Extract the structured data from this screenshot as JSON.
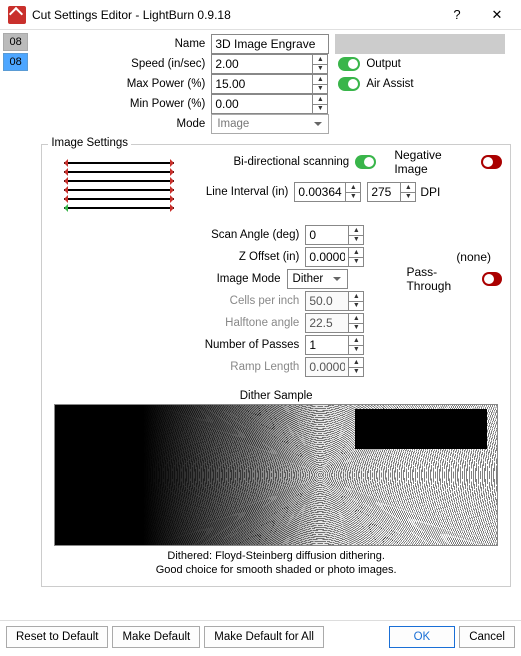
{
  "title": "Cut Settings Editor - LightBurn 0.9.18",
  "layers": [
    "08",
    "08"
  ],
  "top": {
    "name_label": "Name",
    "name_value": "3D Image Engrave",
    "speed_label": "Speed (in/sec)",
    "speed_value": "2.00",
    "maxpower_label": "Max Power (%)",
    "maxpower_value": "15.00",
    "minpower_label": "Min Power (%)",
    "minpower_value": "0.00",
    "mode_label": "Mode",
    "mode_value": "Image",
    "output_label": "Output",
    "airassist_label": "Air Assist"
  },
  "image": {
    "legend": "Image Settings",
    "bidir_label": "Bi-directional scanning",
    "neg_label": "Negative Image",
    "lineint_label": "Line Interval (in)",
    "lineint_value": "0.00364",
    "dpi_value": "275",
    "dpi_label": "DPI",
    "scanangle_label": "Scan Angle (deg)",
    "scanangle_value": "0",
    "zoffset_label": "Z Offset (in)",
    "zoffset_value": "0.0000",
    "zoffset_note": "(none)",
    "imagemode_label": "Image Mode",
    "imagemode_value": "Dither",
    "passthrough_label": "Pass-Through",
    "cells_label": "Cells per inch",
    "cells_value": "50.0",
    "halftone_label": "Halftone angle",
    "halftone_value": "22.5",
    "passes_label": "Number of Passes",
    "passes_value": "1",
    "ramp_label": "Ramp Length",
    "ramp_value": "0.0000"
  },
  "dither": {
    "title": "Dither Sample",
    "line1": "Dithered: Floyd-Steinberg diffusion dithering.",
    "line2": "Good choice for smooth shaded or photo images."
  },
  "footer": {
    "reset": "Reset to Default",
    "makedef": "Make Default",
    "makedefall": "Make Default for All",
    "ok": "OK",
    "cancel": "Cancel"
  }
}
